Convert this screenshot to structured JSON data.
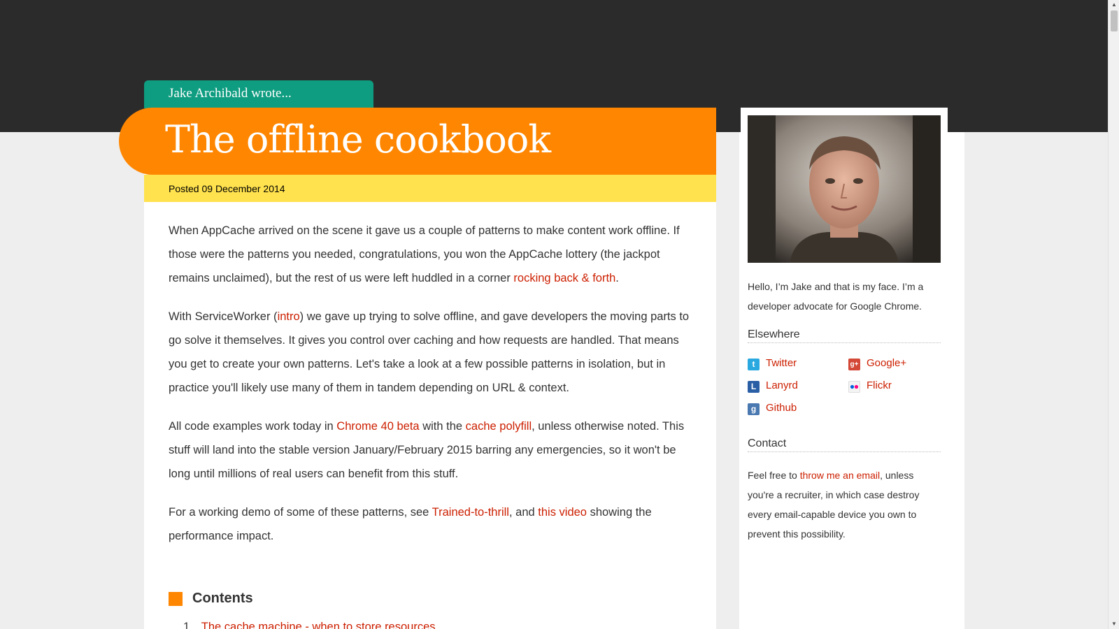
{
  "header": {
    "author_tab": "Jake Archibald wrote...",
    "title": "The offline cookbook",
    "posted": "Posted 09 December 2014"
  },
  "article": {
    "p1": {
      "text": "When AppCache arrived on the scene it gave us a couple of patterns to make content work offline. If those were the patterns you needed, congratulations, you won the AppCache lottery (the jackpot remains unclaimed), but the rest of us were left huddled in a corner ",
      "link": "rocking back & forth",
      "end": "."
    },
    "p2": {
      "a": "With ServiceWorker (",
      "link": "intro",
      "b": ") we gave up trying to solve offline, and gave developers the moving parts to go solve it themselves. It gives you control over caching and how requests are handled. That means you get to create your own patterns. Let's take a look at a few possible patterns in isolation, but in practice you'll likely use many of them in tandem depending on URL & context."
    },
    "p3": {
      "a": "All code examples work today in ",
      "link1": "Chrome 40 beta",
      "b": " with the ",
      "link2": "cache polyfill",
      "c": ", unless otherwise noted. This stuff will land into the stable version January/February 2015 barring any emergencies, so it won't be long until millions of real users can benefit from this stuff."
    },
    "p4": {
      "a": "For a working demo of some of these patterns, see ",
      "link1": "Trained-to-thrill",
      "b": ", and ",
      "link2": "this video",
      "c": " showing the performance impact."
    },
    "contents_title": "Contents",
    "toc": [
      {
        "num": "1.",
        "label": "The cache machine - when to store resources"
      }
    ]
  },
  "sidebar": {
    "intro": "Hello, I’m Jake and that is my face. I’m a developer advocate for Google Chrome.",
    "elsewhere_title": "Elsewhere",
    "links": [
      {
        "label": "Twitter",
        "icon": "twitter-icon",
        "color": "#2aa9e0",
        "glyph": "t"
      },
      {
        "label": "Google+",
        "icon": "google-plus-icon",
        "color": "#d34836",
        "glyph": "g+"
      },
      {
        "label": "Lanyrd",
        "icon": "lanyrd-icon",
        "color": "#2a5fa6",
        "glyph": "L"
      },
      {
        "label": "Flickr",
        "icon": "flickr-icon",
        "color": "#ffffff",
        "glyph": ""
      },
      {
        "label": "Github",
        "icon": "github-icon",
        "color": "#4a78b0",
        "glyph": "g"
      }
    ],
    "contact_title": "Contact",
    "contact": {
      "a": "Feel free to ",
      "link": "throw me an email",
      "b": ", unless you're a recruiter, in which case destroy every email-capable device you own to prevent this possibility."
    }
  },
  "colors": {
    "dark_band": "#2b2b2b",
    "teal": "#0f9d81",
    "orange": "#ff8600",
    "yellow": "#ffe24d",
    "link": "#cc1f00"
  }
}
